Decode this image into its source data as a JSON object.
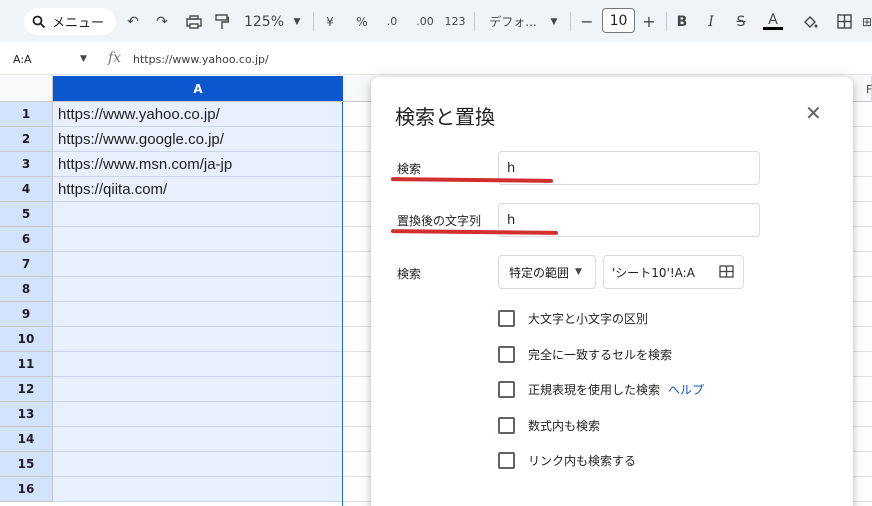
{
  "toolbar": {
    "search_label": "メニュー",
    "zoom": "125%",
    "currency": "¥",
    "percent": "%",
    "decimal_decrease": ".0",
    "decimal_increase": ".00",
    "number_format": "123",
    "font_name": "デフォ...",
    "font_size": "10",
    "minus": "−",
    "plus": "+",
    "bold": "B",
    "italic": "I",
    "strike": "S",
    "text_color": "A"
  },
  "formula_bar": {
    "name_box": "A:A",
    "fx": "fx",
    "formula": "https://www.yahoo.co.jp/"
  },
  "sheet": {
    "columns": [
      "A"
    ],
    "far_column": "F",
    "rows": [
      {
        "num": "1",
        "a": "https://www.yahoo.co.jp/"
      },
      {
        "num": "2",
        "a": "https://www.google.co.jp/"
      },
      {
        "num": "3",
        "a": "https://www.msn.com/ja-jp"
      },
      {
        "num": "4",
        "a": "https://qiita.com/"
      },
      {
        "num": "5",
        "a": ""
      },
      {
        "num": "6",
        "a": ""
      },
      {
        "num": "7",
        "a": ""
      },
      {
        "num": "8",
        "a": ""
      },
      {
        "num": "9",
        "a": ""
      },
      {
        "num": "10",
        "a": ""
      },
      {
        "num": "11",
        "a": ""
      },
      {
        "num": "12",
        "a": ""
      },
      {
        "num": "13",
        "a": ""
      },
      {
        "num": "14",
        "a": ""
      },
      {
        "num": "15",
        "a": ""
      },
      {
        "num": "16",
        "a": ""
      }
    ]
  },
  "dialog": {
    "title": "検索と置換",
    "close": "✕",
    "find_label": "検索",
    "find_value": "h",
    "replace_label": "置換後の文字列",
    "replace_value": "h",
    "scope_label": "検索",
    "scope_select": "特定の範囲",
    "range_value": "'シート10'!A:A",
    "options": [
      {
        "label": "大文字と小文字の区別",
        "checked": false
      },
      {
        "label": "完全に一致するセルを検索",
        "checked": false
      },
      {
        "label": "正規表現を使用した検索",
        "checked": false
      },
      {
        "label": "数式内も検索",
        "checked": false
      },
      {
        "label": "リンク内も検索する",
        "checked": false
      }
    ],
    "help_link": "ヘルプ"
  },
  "colors": {
    "accent": "#0b57d0",
    "selection_fill": "#e8f0fe",
    "row_header_selected": "#d3e3fd",
    "annotation_red": "#d32f2f"
  }
}
